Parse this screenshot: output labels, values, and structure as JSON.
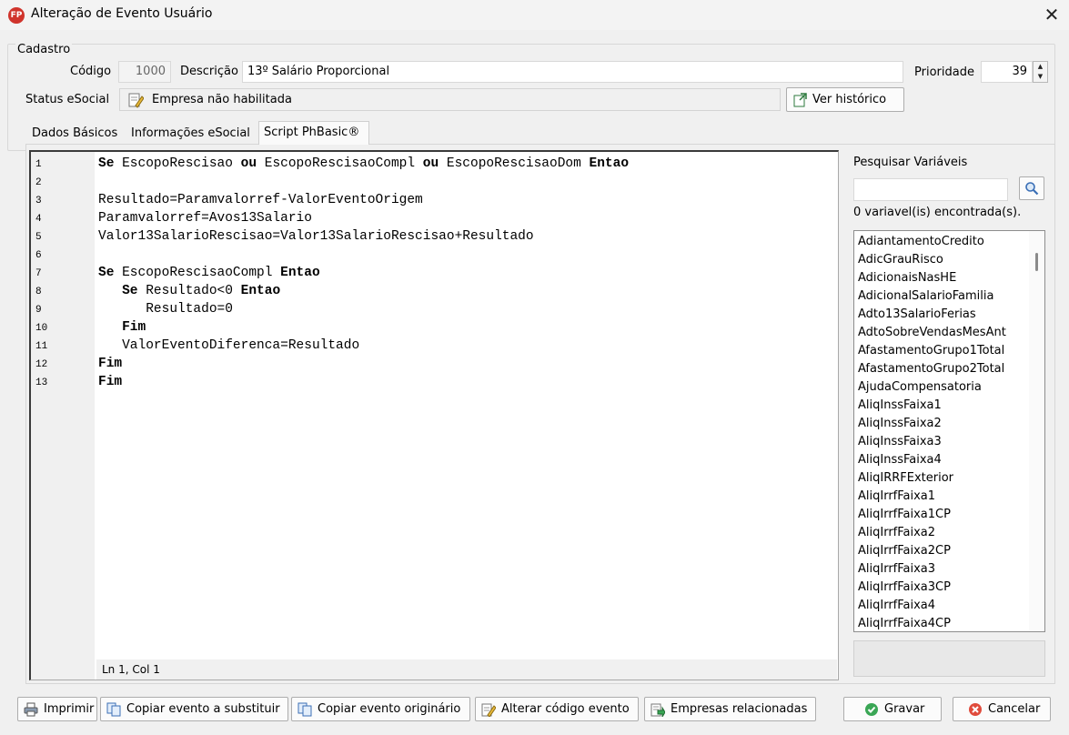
{
  "window": {
    "title": "Alteração de Evento Usuário",
    "icon_text": "FP",
    "close_glyph": "✕"
  },
  "cadastro": {
    "legend": "Cadastro",
    "codigo_label": "Código",
    "codigo_value": "1000",
    "descricao_label": "Descrição",
    "descricao_value": "13º Salário Proporcional",
    "prioridade_label": "Prioridade",
    "prioridade_value": "39",
    "status_label": "Status eSocial",
    "status_value": "Empresa não habilitada",
    "historico_button": "Ver histórico"
  },
  "tabs": [
    {
      "label": "Dados Básicos",
      "active": false
    },
    {
      "label": "Informações eSocial",
      "active": false
    },
    {
      "label": "Script PhBasic®",
      "active": true
    }
  ],
  "editor": {
    "lines": [
      {
        "no": "1",
        "text": "Se EscopoRescisao ou EscopoRescisaoCompl ou EscopoRescisaoDom Entao"
      },
      {
        "no": "2",
        "text": ""
      },
      {
        "no": "3",
        "text": "Resultado=Paramvalorref-ValorEventoOrigem"
      },
      {
        "no": "4",
        "text": "Paramvalorref=Avos13Salario"
      },
      {
        "no": "5",
        "text": "Valor13SalarioRescisao=Valor13SalarioRescisao+Resultado"
      },
      {
        "no": "6",
        "text": ""
      },
      {
        "no": "7",
        "text": "Se EscopoRescisaoCompl Entao"
      },
      {
        "no": "8",
        "text": "   Se Resultado<0 Entao"
      },
      {
        "no": "9",
        "text": "      Resultado=0"
      },
      {
        "no": "10",
        "text": "   Fim"
      },
      {
        "no": "11",
        "text": "   ValorEventoDiferenca=Resultado"
      },
      {
        "no": "12",
        "text": "Fim"
      },
      {
        "no": "13",
        "text": "Fim"
      }
    ],
    "keywords": [
      "Se",
      "ou",
      "Entao",
      "Fim"
    ],
    "cursor_status": "Ln 1, Col 1"
  },
  "variables": {
    "search_label": "Pesquisar Variáveis",
    "search_value": "",
    "found_text": "0 variavel(is) encontrada(s).",
    "items": [
      "AdiantamentoCredito",
      "AdicGrauRisco",
      "AdicionaisNasHE",
      "AdicionalSalarioFamilia",
      "Adto13SalarioFerias",
      "AdtoSobreVendasMesAnt",
      "AfastamentoGrupo1Total",
      "AfastamentoGrupo2Total",
      "AjudaCompensatoria",
      "AliqInssFaixa1",
      "AliqInssFaixa2",
      "AliqInssFaixa3",
      "AliqInssFaixa4",
      "AliqIRRFExterior",
      "AliqIrrfFaixa1",
      "AliqIrrfFaixa1CP",
      "AliqIrrfFaixa2",
      "AliqIrrfFaixa2CP",
      "AliqIrrfFaixa3",
      "AliqIrrfFaixa3CP",
      "AliqIrrfFaixa4",
      "AliqIrrfFaixa4CP"
    ]
  },
  "footer": {
    "imprimir": "Imprimir",
    "copiar_substituir": "Copiar evento a substituir",
    "copiar_originario": "Copiar evento originário",
    "alterar_codigo": "Alterar código evento",
    "empresas": "Empresas relacionadas",
    "gravar": "Gravar",
    "cancelar": "Cancelar"
  },
  "colors": {
    "cancel_icon": "#e04b3c",
    "save_icon": "#3aa655",
    "search_icon": "#3b6fb6"
  }
}
